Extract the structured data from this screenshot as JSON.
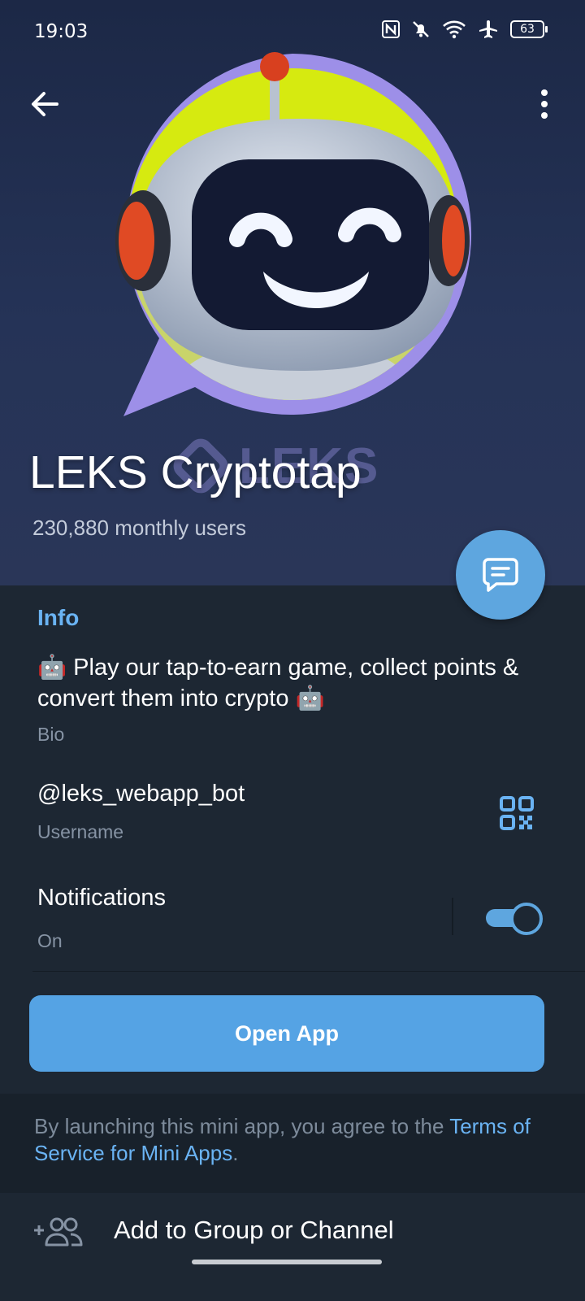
{
  "status_bar": {
    "time": "19:03",
    "battery": "63",
    "icons": [
      "nfc-icon",
      "mute-bell-icon",
      "wifi-icon",
      "airplane-icon",
      "battery-icon"
    ]
  },
  "toolbar": {
    "back_icon": "arrow-left-icon",
    "menu_icon": "more-vertical-icon"
  },
  "profile": {
    "name": "LEKS Cryptotap",
    "monthly_users": "230,880 monthly users",
    "watermark": "LEKS"
  },
  "info": {
    "header": "Info",
    "bio": "🤖 Play our tap-to-earn game, collect points & convert them into crypto 🤖",
    "bio_label": "Bio",
    "username": "@leks_webapp_bot",
    "username_label": "Username",
    "notifications_title": "Notifications",
    "notifications_state": "On",
    "notifications_enabled": true
  },
  "open_app": {
    "label": "Open App"
  },
  "terms": {
    "prefix": "By launching this mini app, you agree to the ",
    "link": "Terms of Service for Mini Apps",
    "suffix": "."
  },
  "add_to_group": {
    "label": "Add to Group or Channel"
  },
  "colors": {
    "accent": "#6ab3f3",
    "button": "#55a3e4",
    "background": "#1d2733",
    "hero": "#253357"
  }
}
